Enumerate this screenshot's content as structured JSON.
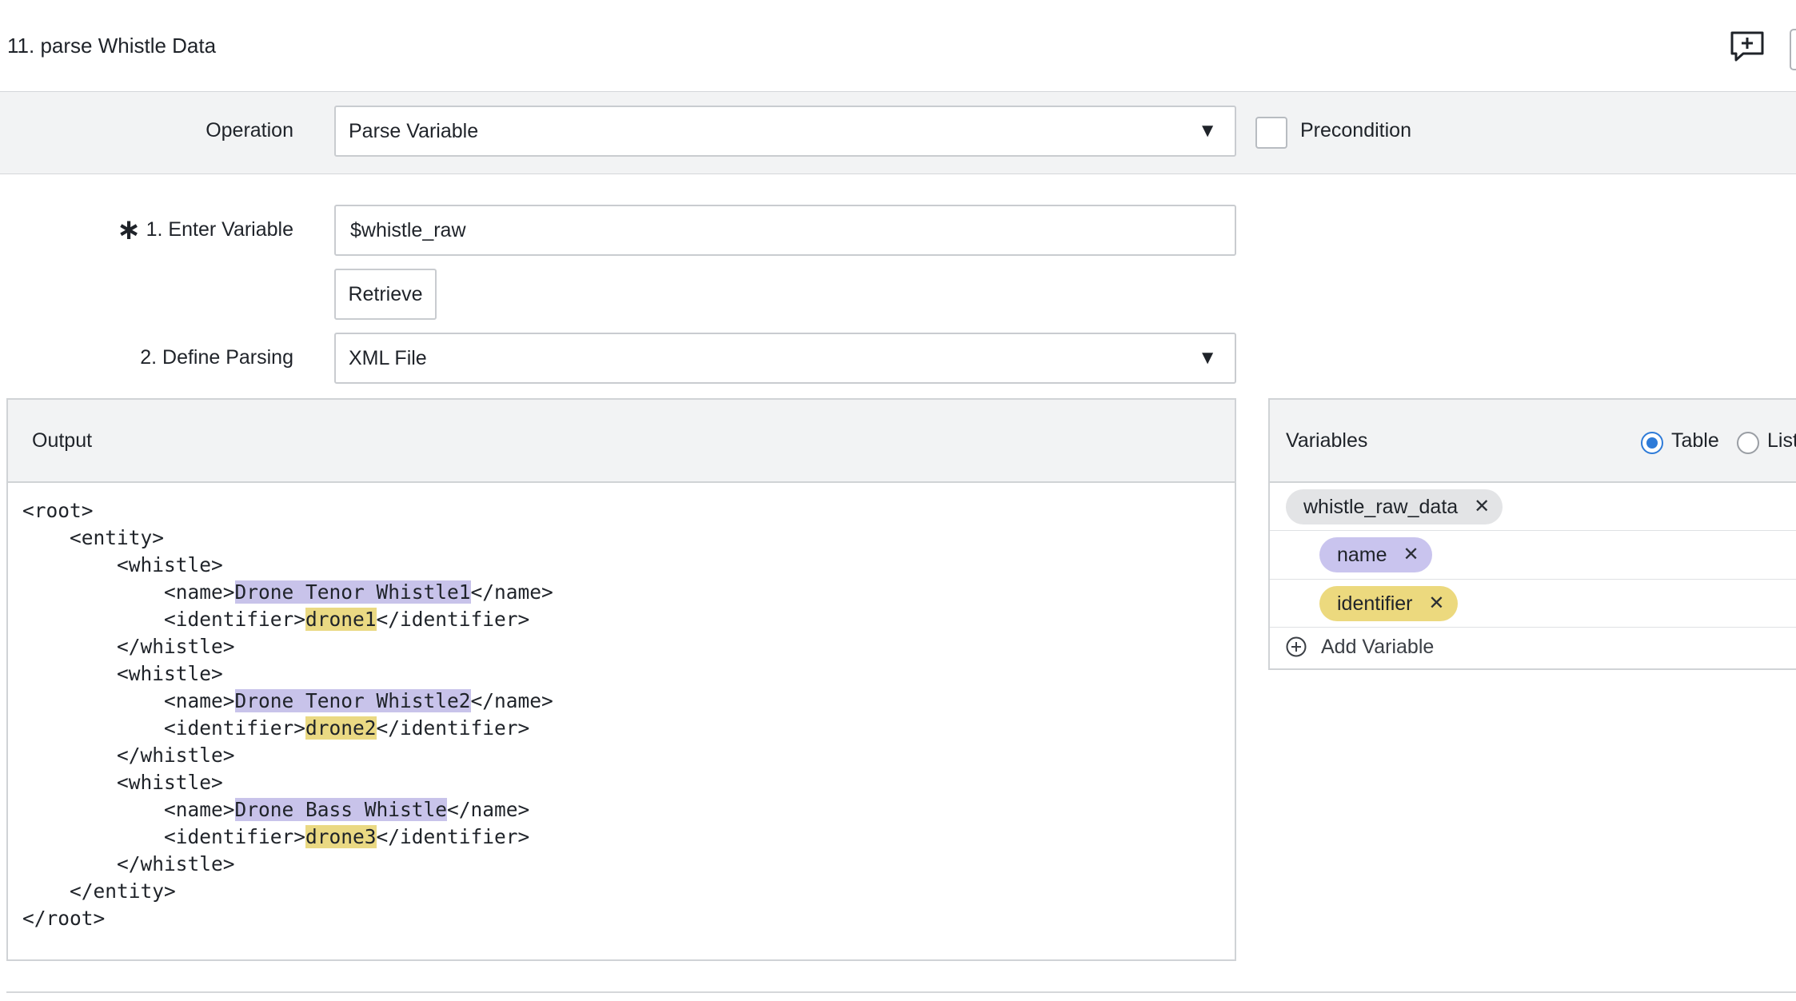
{
  "step": {
    "title": "11. parse Whistle Data"
  },
  "operation": {
    "label": "Operation",
    "selected": "Parse Variable",
    "precondition_label": "Precondition",
    "precondition_checked": false
  },
  "step1": {
    "required_mark": "∗",
    "label": "1. Enter Variable",
    "value": "$whistle_raw",
    "retrieve_label": "Retrieve"
  },
  "step2": {
    "label": "2. Define Parsing",
    "selected": "XML File"
  },
  "output": {
    "title": "Output",
    "lines": [
      {
        "pre": "<root>",
        "hl": "",
        "post": ""
      },
      {
        "pre": "    <entity>",
        "hl": "",
        "post": ""
      },
      {
        "pre": "        <whistle>",
        "hl": "",
        "post": ""
      },
      {
        "pre": "            <name>",
        "hl": "Drone Tenor Whistle1",
        "post": "</name>"
      },
      {
        "pre": "            <identifier>",
        "hl": "drone1",
        "post": "</identifier>"
      },
      {
        "pre": "        </whistle>",
        "hl": "",
        "post": ""
      },
      {
        "pre": "        <whistle>",
        "hl": "",
        "post": ""
      },
      {
        "pre": "            <name>",
        "hl": "Drone Tenor Whistle2",
        "post": "</name>"
      },
      {
        "pre": "            <identifier>",
        "hl": "drone2",
        "post": "</identifier>"
      },
      {
        "pre": "        </whistle>",
        "hl": "",
        "post": ""
      },
      {
        "pre": "        <whistle>",
        "hl": "",
        "post": ""
      },
      {
        "pre": "            <name>",
        "hl": "Drone Bass Whistle",
        "post": "</name>"
      },
      {
        "pre": "            <identifier>",
        "hl": "drone3",
        "post": "</identifier>"
      },
      {
        "pre": "        </whistle>",
        "hl": "",
        "post": ""
      },
      {
        "pre": "    </entity>",
        "hl": "",
        "post": ""
      },
      {
        "pre": "</root>",
        "hl": "",
        "post": ""
      }
    ]
  },
  "variables": {
    "title": "Variables",
    "view_options": [
      "Table",
      "List"
    ],
    "view_selected": "Table",
    "root_var": "whistle_raw_data",
    "child_vars": [
      "name",
      "identifier"
    ],
    "remove_glyph": "✕",
    "add_label": "Add Variable"
  },
  "colors": {
    "name_highlight": "#c8c3ea",
    "identifier_highlight": "#ead983",
    "accent": "#2e7bd8",
    "band": "#f2f3f4"
  },
  "icons": {
    "comment": "comment-add-icon",
    "caret": "chevron-down-icon",
    "remove": "close-icon",
    "add": "plus-circle-icon"
  }
}
